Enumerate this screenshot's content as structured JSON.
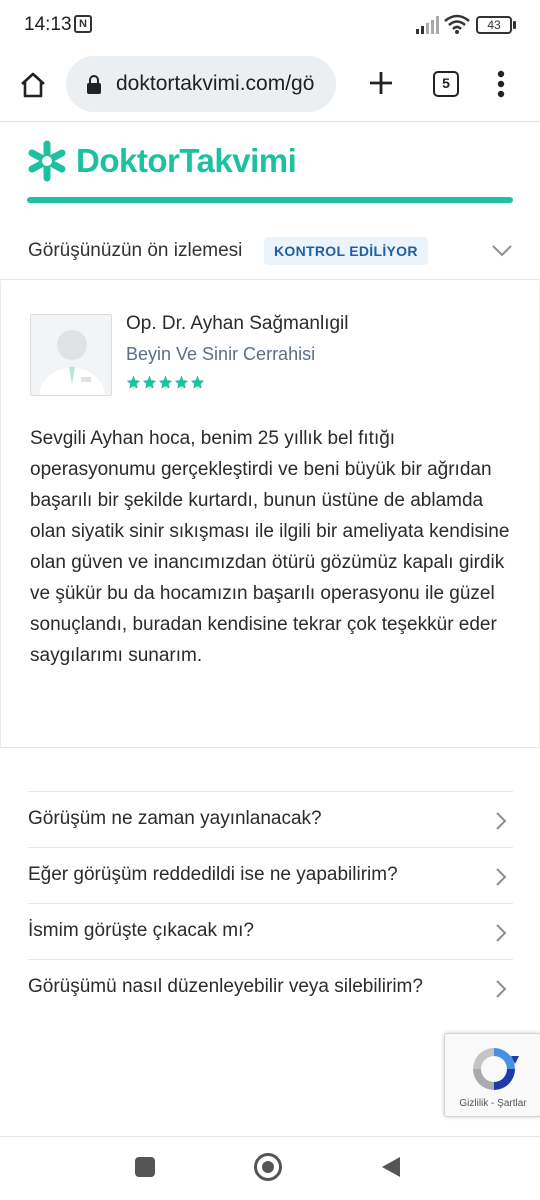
{
  "status_bar": {
    "time": "14:13",
    "nfc_symbol": "N",
    "battery": "43"
  },
  "browser": {
    "url": "doktortakvimi.com/gö",
    "tab_count": "5"
  },
  "brand": {
    "name": "DoktorTakvimi",
    "color": "#1dc1a0"
  },
  "preview": {
    "title": "Görüşünüzün ön izlemesi",
    "status_badge": "KONTROL EDİLİYOR"
  },
  "review": {
    "doctor_name": "Op. Dr. Ayhan Sağmanlıgil",
    "specialty": "Beyin Ve Sinir Cerrahisi",
    "rating": 5,
    "rating_max": 5,
    "text": "Sevgili Ayhan hoca, benim 25 yıllık bel fıtığı operasyonumu gerçekleştirdi ve beni büyük bir ağrıdan başarılı bir şekilde kurtardı, bunun üstüne de ablamda olan siyatik sinir sıkışması ile ilgili bir ameliyata kendisine olan güven ve inancımızdan ötürü gözümüz kapalı girdik ve şükür bu da hocamızın başarılı operasyonu ile güzel sonuçlandı, buradan kendisine tekrar çok teşekkür eder saygılarımı sunarım."
  },
  "faq": [
    {
      "label": "Görüşüm ne zaman yayınlanacak?"
    },
    {
      "label": "Eğer görüşüm reddedildi ise ne yapabilirim?"
    },
    {
      "label": "İsmim görüşte çıkacak mı?"
    },
    {
      "label": "Görüşümü nasıl düzenleyebilir veya silebilirim?"
    }
  ],
  "recaptcha": {
    "links": "Gizlilik - Şartlar"
  }
}
